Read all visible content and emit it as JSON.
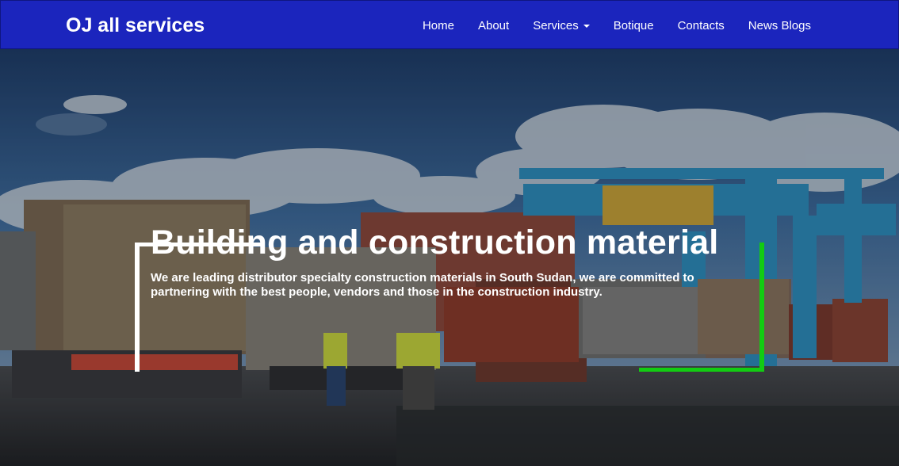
{
  "navbar": {
    "brand": "OJ all services",
    "links": [
      {
        "label": "Home"
      },
      {
        "label": "About"
      },
      {
        "label": "Services",
        "has_dropdown": true
      },
      {
        "label": "Botique"
      },
      {
        "label": "Contacts"
      },
      {
        "label": "News Blogs"
      }
    ],
    "background_color": "#1b25bd"
  },
  "hero": {
    "title": "Building and construction material",
    "subtitle": "We are leading distributor specialty construction materials in South Sudan, we are committed to partnering with the best people, vendors and those in the construction industry.",
    "accent_color": "#12cc12",
    "background_image": "port-with-containers-and-gantry-crane"
  },
  "icons": {
    "dropdown": "caret-down-icon"
  }
}
